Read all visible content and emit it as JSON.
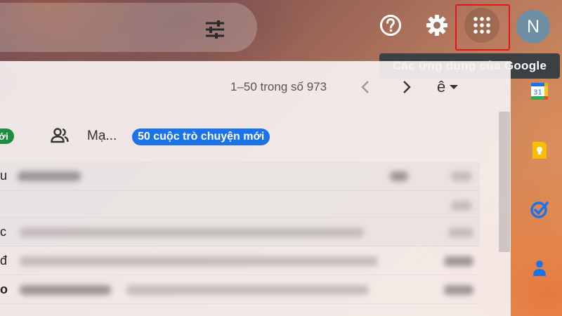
{
  "header": {
    "tooltip": "Các ứng dụng của Google",
    "avatar_initial": "N",
    "icons": [
      "search-options-icon",
      "help-icon",
      "settings-icon",
      "apps-grid-icon"
    ]
  },
  "toolbar": {
    "pager": "1–50 trong số 973"
  },
  "tabs": {
    "left_badge": "ới",
    "social_label": "Mạ...",
    "new_badge": "50 cuộc trò chuyện mới"
  },
  "rows": [
    {
      "lead": "u",
      "bold": false
    },
    {
      "lead": "",
      "bold": false
    },
    {
      "lead": "c",
      "bold": false
    },
    {
      "lead": "đ",
      "bold": false
    },
    {
      "lead": "o",
      "bold": true
    }
  ],
  "side_panel": {
    "calendar_day": "31"
  },
  "colors": {
    "accent_blue": "#1a73e8",
    "green_badge": "#1e8e3e",
    "highlight_red": "#e2161b",
    "avatar_bg": "#6e8fa3"
  }
}
